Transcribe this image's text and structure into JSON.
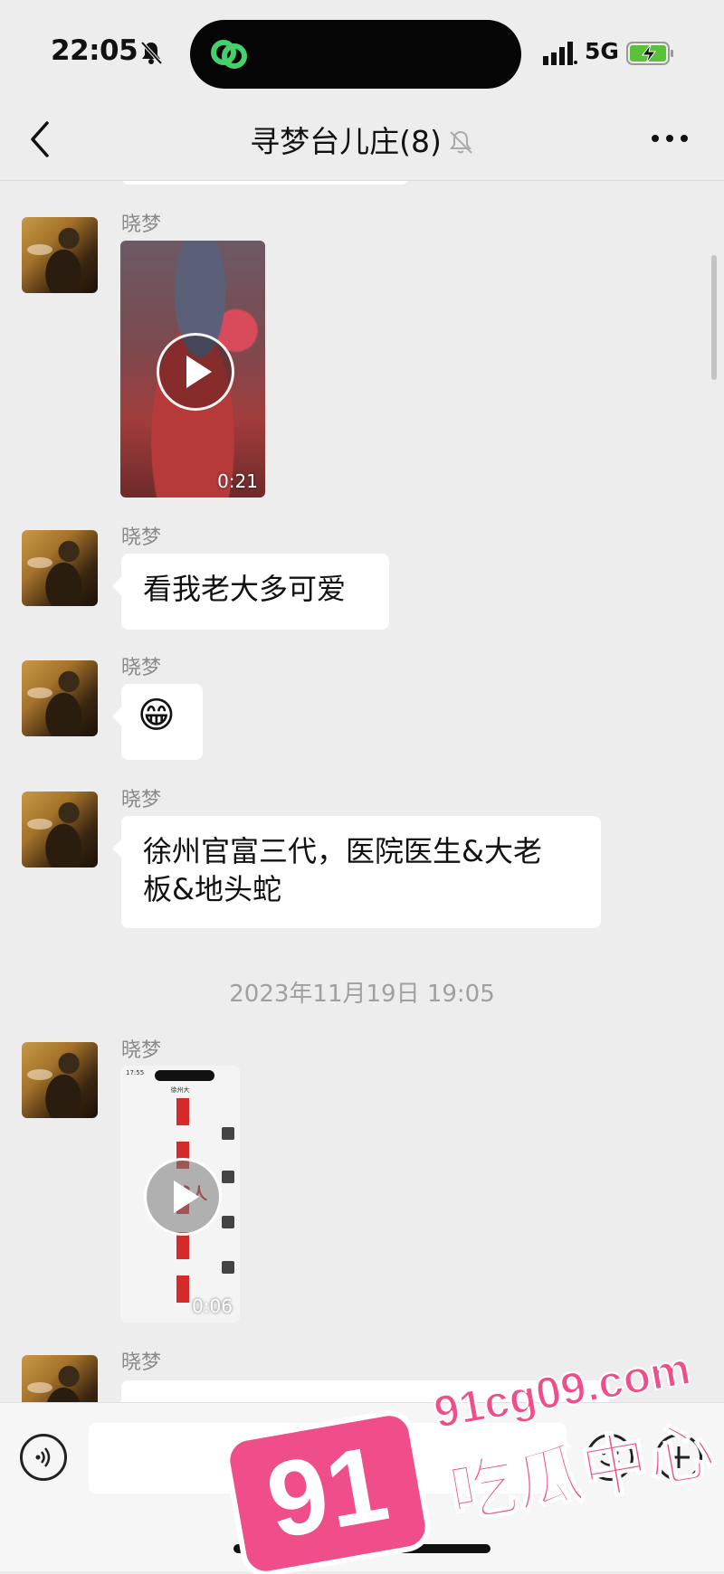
{
  "status_bar": {
    "time": "22:05",
    "network": "5G"
  },
  "nav": {
    "title": "寻梦台儿庄(8)"
  },
  "messages": [
    {
      "sender": "晓梦",
      "type": "video",
      "duration": "0:21"
    },
    {
      "sender": "晓梦",
      "type": "text",
      "text": "看我老大多可爱"
    },
    {
      "sender": "晓梦",
      "type": "emoji",
      "emoji": "😁"
    },
    {
      "sender": "晓梦",
      "type": "text",
      "line1": "徐州官富三代，医院医生&大老",
      "line2": "板&地头蛇"
    },
    {
      "sender": "晓梦",
      "type": "video",
      "duration": "0:06"
    },
    {
      "sender": "晓梦",
      "type": "text",
      "text": ""
    }
  ],
  "timestamp": "2023年11月19日 19:05",
  "video2_inner": {
    "time": "17:55",
    "title": "徐州大",
    "overlay": "贱人"
  },
  "watermark": {
    "badge": "91",
    "domain": "91cg09.com",
    "label": "吃瓜中心"
  },
  "colors": {
    "background": "#ededed",
    "bubble": "#ffffff",
    "watermark": "#ef4e8a",
    "battery": "#5ac13a"
  }
}
